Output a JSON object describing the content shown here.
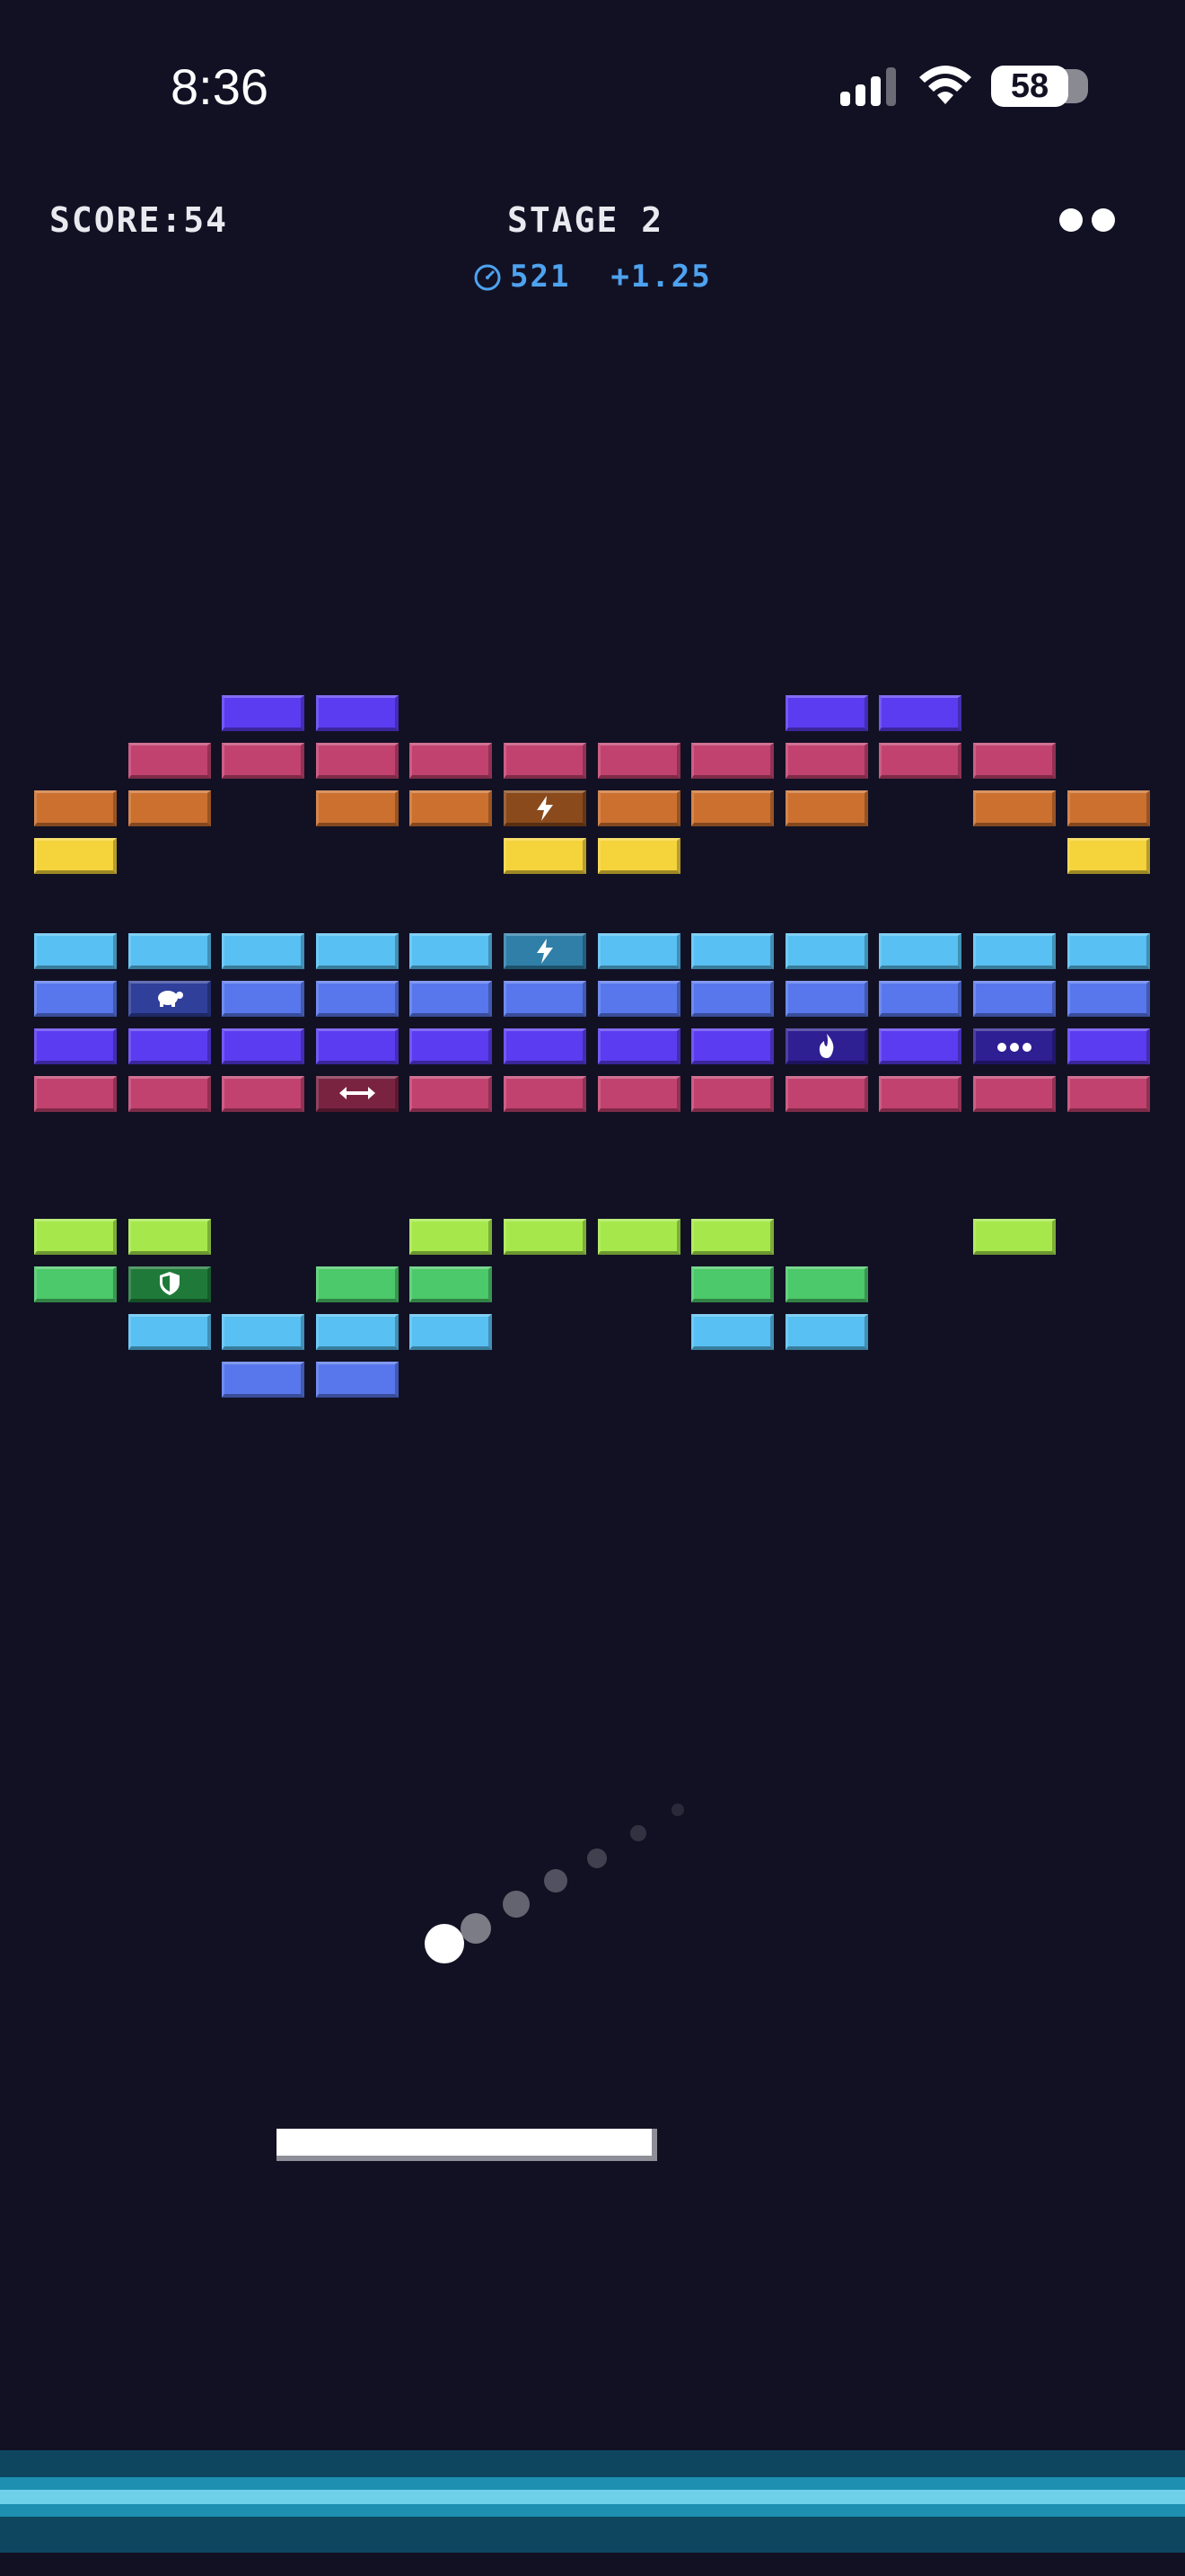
{
  "status_bar": {
    "time": "8:36",
    "battery": "58",
    "icons": [
      "cellular-signal-icon",
      "wifi-icon",
      "battery-icon"
    ]
  },
  "hud": {
    "score_label": "SCORE:",
    "score": "54",
    "stage_label": "STAGE",
    "stage": "2",
    "timer_icon": "stopwatch-icon",
    "timer_value": "521",
    "multiplier": "+1.25",
    "lives": 2
  },
  "colors": {
    "background": "#121124",
    "violet": "#5b3cf0",
    "magenta": "#c2426f",
    "orange": "#cc7030",
    "yellow": "#f5d33b",
    "cyan": "#58c0f2",
    "blue": "#5877ec",
    "lime": "#a6e84b",
    "green": "#4cc96a",
    "timer": "#4ea3f0"
  },
  "bricks": [
    {
      "color": "violet",
      "cells": [
        2,
        3,
        8,
        9
      ]
    },
    {
      "color": "magenta",
      "cells": [
        1,
        2,
        3,
        4,
        5,
        6,
        7,
        8,
        9,
        10
      ]
    },
    {
      "color": "orange",
      "cells": [
        0,
        1,
        3,
        4,
        5,
        6,
        7,
        8,
        10,
        11
      ],
      "powerups": {
        "5": "lightning-icon"
      }
    },
    {
      "color": "yellow",
      "cells": [
        0,
        5,
        6,
        11
      ]
    },
    {
      "gap": true
    },
    {
      "color": "cyan",
      "cells": [
        0,
        1,
        2,
        3,
        4,
        5,
        6,
        7,
        8,
        9,
        10,
        11
      ],
      "powerups": {
        "5": "lightning-icon"
      }
    },
    {
      "color": "blue",
      "cells": [
        0,
        1,
        2,
        3,
        4,
        5,
        6,
        7,
        8,
        9,
        10,
        11
      ],
      "powerups": {
        "1": "turtle-icon"
      }
    },
    {
      "color": "violet",
      "cells": [
        0,
        1,
        2,
        3,
        4,
        5,
        6,
        7,
        8,
        9,
        10,
        11
      ],
      "powerups": {
        "8": "flame-icon",
        "10": "multiball-icon"
      }
    },
    {
      "color": "magenta",
      "cells": [
        0,
        1,
        2,
        3,
        4,
        5,
        6,
        7,
        8,
        9,
        10,
        11
      ],
      "powerups": {
        "3": "expand-icon"
      }
    },
    {
      "gap": true
    },
    {
      "gap": true
    },
    {
      "color": "lime",
      "cells": [
        0,
        1,
        4,
        5,
        6,
        7,
        10
      ]
    },
    {
      "color": "green",
      "cells": [
        0,
        1,
        3,
        4,
        7,
        8
      ],
      "powerups": {
        "1": "shield-icon"
      }
    },
    {
      "color": "cyan",
      "cells": [
        1,
        2,
        3,
        4,
        7,
        8
      ]
    },
    {
      "color": "blue",
      "cells": [
        2,
        3
      ]
    }
  ]
}
